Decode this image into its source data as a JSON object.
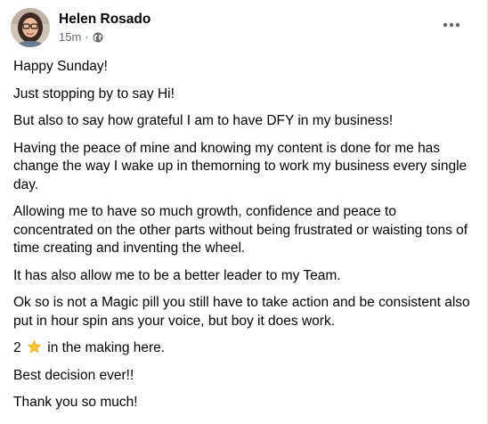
{
  "post": {
    "author": "Helen Rosado",
    "timestamp": "15m",
    "separator": "·",
    "privacy_icon": "globe-icon",
    "more_icon": "more-options-icon",
    "paragraphs": [
      "Happy Sunday!",
      "Just stopping by to say Hi!",
      "But also to say how grateful I am to have DFY in my business!",
      "Having the peace of mine and knowing my content is done for me has change the way I wake up in themorning to work my business every single day.",
      "Allowing me to have so much growth, confidence and peace to concentrated on the other parts without being frustrated or waisting tons of time creating and inventing the wheel.",
      "It has also allow me to be a better leader to my Team.",
      "Ok so is not a Magic pill you still have to take action and be consistent also put in hour spin ans your voice, but boy it does work."
    ],
    "star_line": {
      "before": "2",
      "icon": "star-emoji-icon",
      "after": "in the making here."
    },
    "closing": [
      "Best decision ever!!",
      "Thank you so much!"
    ]
  },
  "colors": {
    "text": "#050505",
    "secondary_text": "#65676b",
    "star": "#f7c32e"
  }
}
